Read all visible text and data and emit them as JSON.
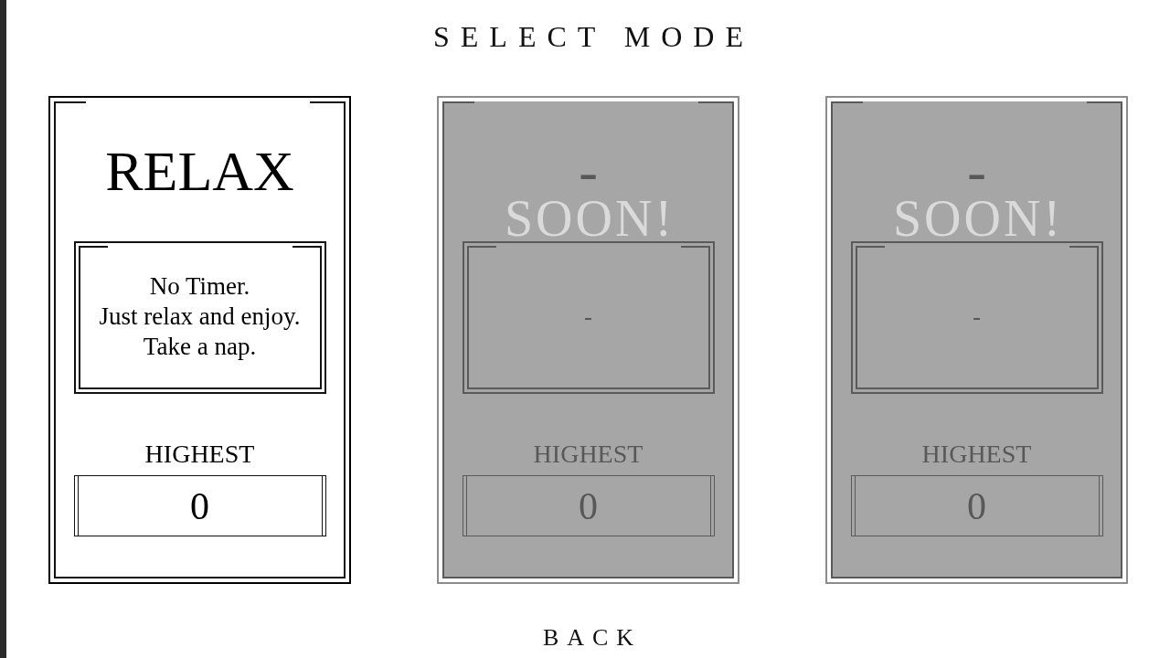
{
  "title": "SELECT MODE",
  "modes": [
    {
      "name": "RELAX",
      "description": "No Timer.\nJust relax and enjoy.\nTake a nap.",
      "score_label": "HIGHEST",
      "score": "0",
      "locked": false
    },
    {
      "name": "-",
      "description": "-",
      "score_label": "HIGHEST",
      "score": "0",
      "locked": true,
      "overlay_label": "SOON!"
    },
    {
      "name": "-",
      "description": "-",
      "score_label": "HIGHEST",
      "score": "0",
      "locked": true,
      "overlay_label": "SOON!"
    }
  ],
  "back_button": "BACK"
}
